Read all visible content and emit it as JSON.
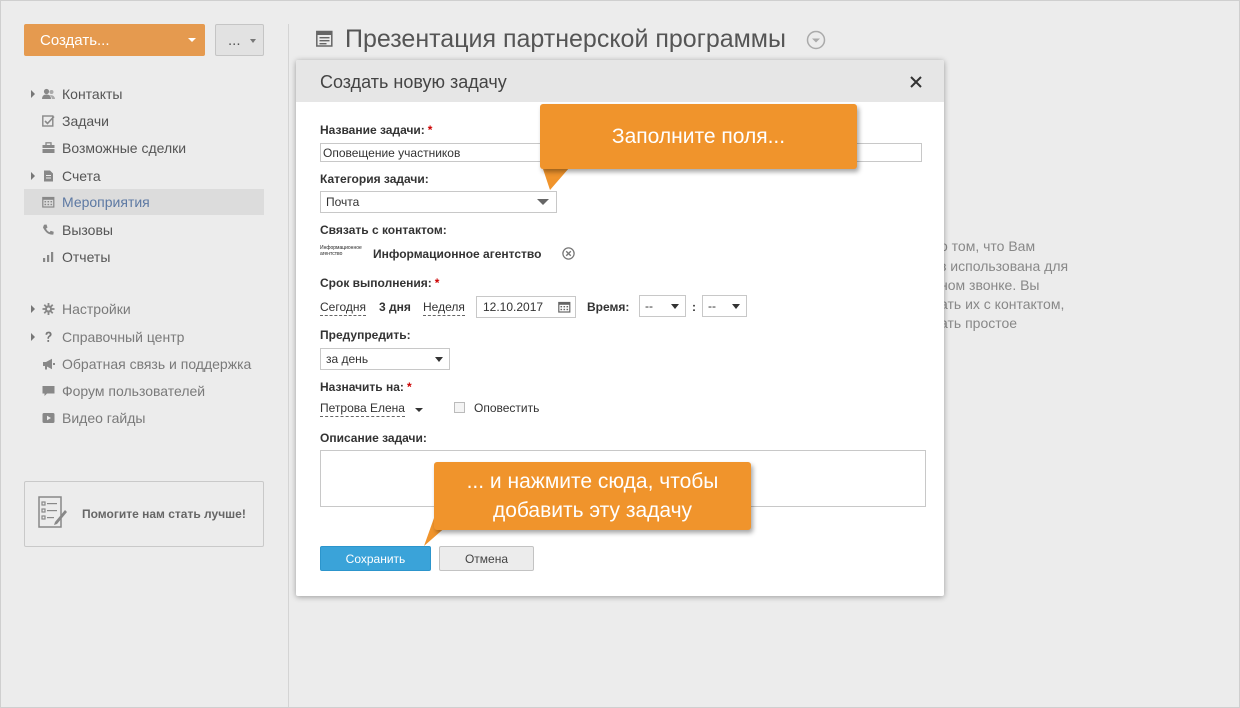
{
  "sidebar": {
    "create_label": "Создать...",
    "more_label": "...",
    "items": [
      {
        "label": "Контакты",
        "icon": "contacts-icon",
        "expandable": true
      },
      {
        "label": "Задачи",
        "icon": "tasks-icon",
        "expandable": false
      },
      {
        "label": "Возможные сделки",
        "icon": "deals-icon",
        "expandable": false
      },
      {
        "label": "Счета",
        "icon": "invoices-icon",
        "expandable": true
      },
      {
        "label": "Мероприятия",
        "icon": "calendar-icon",
        "expandable": false,
        "active": true
      },
      {
        "label": "Вызовы",
        "icon": "phone-icon",
        "expandable": false
      },
      {
        "label": "Отчеты",
        "icon": "reports-icon",
        "expandable": false
      }
    ],
    "secondary": [
      {
        "label": "Настройки",
        "icon": "gear-icon",
        "expandable": true
      },
      {
        "label": "Справочный центр",
        "icon": "help-icon",
        "expandable": true
      },
      {
        "label": "Обратная связь и поддержка",
        "icon": "megaphone-icon",
        "expandable": false
      },
      {
        "label": "Форум пользователей",
        "icon": "forum-icon",
        "expandable": false
      },
      {
        "label": "Видео гайды",
        "icon": "video-icon",
        "expandable": false
      }
    ],
    "feedback_label": "Помогите нам стать лучше!"
  },
  "main": {
    "title": "Презентация партнерской программы",
    "background_text": [
      "о том, что Вам",
      "з использована для",
      "ном звонке. Вы",
      "ать их с контактом,",
      "ать простое"
    ]
  },
  "dialog": {
    "title": "Создать новую задачу",
    "task_name_label": "Название задачи:",
    "task_name_value": "Оповещение участников",
    "category_label": "Категория задачи:",
    "category_value": "Почта",
    "contact_label": "Связать с контактом:",
    "contact_logo_text": "Информационное агентство",
    "contact_name": "Информационное агентство",
    "due_label": "Срок выполнения:",
    "due_today": "Сегодня",
    "due_3days": "3 дня",
    "due_week": "Неделя",
    "due_date": "12.10.2017",
    "time_label": "Время:",
    "time_hours": "--",
    "time_sep": ":",
    "time_minutes": "--",
    "remind_label": "Предупредить:",
    "remind_value": "за день",
    "assign_label": "Назначить на:",
    "assignee": "Петрова Елена",
    "notify_label": "Оповестить",
    "description_label": "Описание задачи:",
    "save_label": "Сохранить",
    "cancel_label": "Отмена"
  },
  "callouts": {
    "fill_fields": "Заполните поля...",
    "click_here_line1": "... и нажмите сюда, чтобы",
    "click_here_line2": "добавить эту задачу"
  },
  "colors": {
    "accent_orange": "#e59a4f",
    "callout_orange": "#f0942c",
    "save_blue": "#3aa3d9",
    "active_nav_text": "#5d79a3"
  }
}
